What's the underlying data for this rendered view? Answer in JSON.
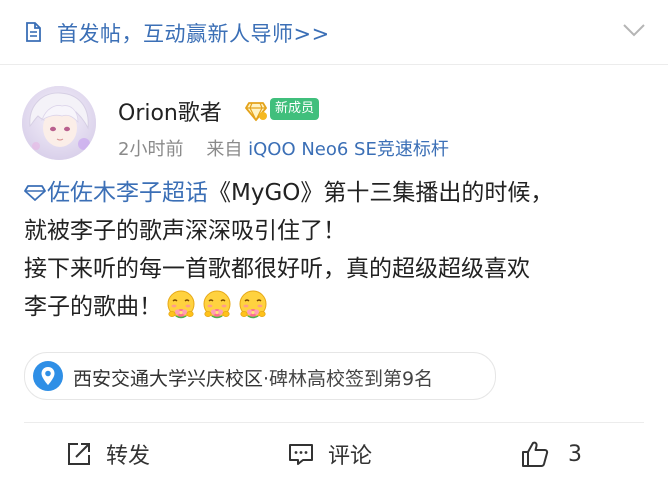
{
  "banner": {
    "text": "首发帖，互动赢新人导师>>",
    "icon": "document-icon",
    "collapse_icon": "chevron-down-icon"
  },
  "post": {
    "author": {
      "name": "Orion歌者",
      "vip_icon": "vip-diamond-icon",
      "badge": "新成员"
    },
    "time": "2小时前",
    "source_prefix": "来自",
    "device": "iQOO Neo6 SE竞速标杆",
    "topic": "佐佐木李子超话",
    "text_line1": "《MyGO》第十三集播出的时候，",
    "text_line2": "就被李子的歌声深深吸引住了！",
    "text_line3": "接下来听的每一首歌都很好听，真的超级超级喜欢",
    "text_line4": "李子的歌曲！",
    "emoji_count": 3,
    "emoji_name": "flower-hug-emoji"
  },
  "location": {
    "name": "西安交通大学兴庆校区",
    "detail": "·碑林高校签到第9名",
    "icon": "location-pin-icon"
  },
  "actions": {
    "repost_label": "转发",
    "comment_label": "评论",
    "like_count": "3"
  },
  "colors": {
    "link": "#3b6fb6",
    "badge_green": "#40bf7c",
    "pin_blue": "#2f8fe6",
    "meta_gray": "#8a8a8a"
  }
}
